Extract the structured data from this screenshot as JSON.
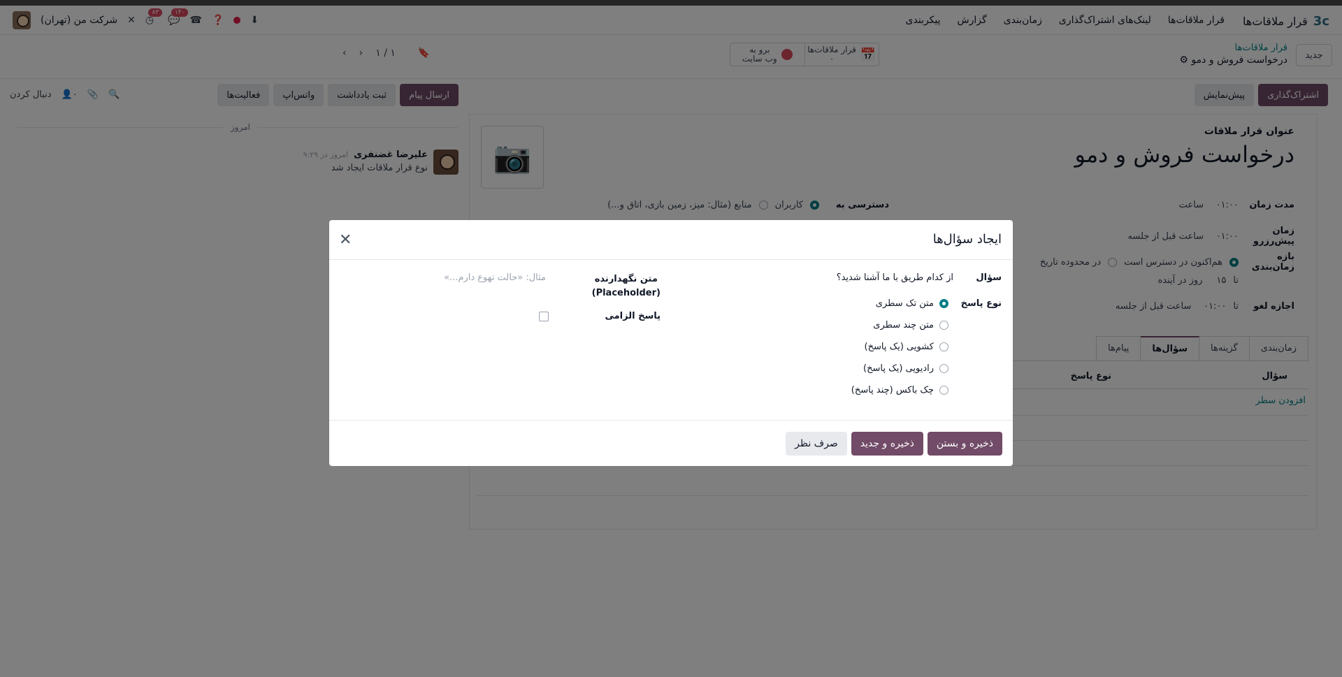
{
  "app": {
    "name": "قرار ملاقات‌ها",
    "logo_text": "3c"
  },
  "menu": [
    "قرار ملاقات‌ها",
    "لینک‌های اشتراک‌گذاری",
    "زمان‌بندی",
    "گزارش",
    "پیکربندی"
  ],
  "navbar": {
    "company": "شرکت من (تهران)",
    "activity_count": "۸۳",
    "message_count": "۱۴۰"
  },
  "breadcrumb": {
    "parent": "قرار ملاقات‌ها",
    "current": "درخواست فروش و دمو"
  },
  "control": {
    "new_label": "جدید",
    "stat_appointments_label": "قرار ملاقات‌ها",
    "stat_appointments_value": "۰",
    "stat_website_label": "برو به",
    "stat_website_sub": "وب سایت",
    "pager_value": "۱ / ۱"
  },
  "chatter": {
    "send_message": "ارسال پیام",
    "log_note": "ثبت یادداشت",
    "whatsapp": "واتس‌اپ",
    "activities": "فعالیت‌ها",
    "follow": "دنبال کردن",
    "followers_count": "۰",
    "today": "امروز",
    "message": {
      "author": "علیرضا غضنفری",
      "time": "امروز در ۹:۲۹",
      "body": "نوع قرار ملاقات ایجاد شد"
    }
  },
  "form_actions": {
    "share": "اشتراک‌گذاری",
    "preview": "پیش‌نمایش"
  },
  "form": {
    "title_label": "عنوان قرار ملاقات",
    "title": "درخواست فروش و دمو",
    "duration_label": "مدت زمان",
    "duration_value": "۰۱:۰۰",
    "duration_unit": "ساعت",
    "booking_label": "زمان پیش‌رزرو",
    "booking_value": "۰۱:۰۰",
    "booking_unit": "ساعت قبل از جلسه",
    "schedule_label": "بازه زمان‌بندی",
    "schedule_opt1": "هم‌اکنون در دسترس است",
    "schedule_opt2": "در محدوده تاریخ",
    "until_label": "تا",
    "until_value": "۱۵",
    "until_unit": "روز در آینده",
    "cancel_label": "اجازه لغو",
    "cancel_value": "۰۱:۰۰",
    "cancel_unit": "ساعت قبل از جلسه",
    "access_label": "دسترسی به",
    "access_opt1": "کاربران",
    "access_opt2": "منابع (مثال: میز، زمین بازی، اتاق و...)"
  },
  "tabs": [
    "زمان‌بندی",
    "گزینه‌ها",
    "سؤال‌ها",
    "پیام‌ها"
  ],
  "active_tab": "سؤال‌ها",
  "questions_table": {
    "col_question": "سؤال",
    "col_type": "نوع پاسخ",
    "add_line": "افزودن سطر"
  },
  "modal": {
    "title": "ایجاد سؤال‌ها",
    "question_label": "سؤال",
    "question_value": "از کدام طریق با ما آشنا شدید؟",
    "answer_type_label": "نوع پاسخ",
    "answer_types": [
      "متن تک سطری",
      "متن چند سطری",
      "کشویی (یک پاسخ)",
      "رادیویی (یک پاسخ)",
      "چک باکس (چند پاسخ)"
    ],
    "selected_answer_type": "متن تک سطری",
    "placeholder_label": "متن نگهدارنده",
    "placeholder_label_en": "(Placeholder)",
    "placeholder_value": "مثال: «حالت تهوع دارم...»",
    "required_label": "پاسخ الزامی",
    "required": false,
    "save_close": "ذخیره و بستن",
    "save_new": "ذخیره و جدید",
    "discard": "صرف نظر"
  },
  "colors": {
    "primary": "#714b67",
    "accent": "#017e84",
    "badge": "#d9485f"
  }
}
